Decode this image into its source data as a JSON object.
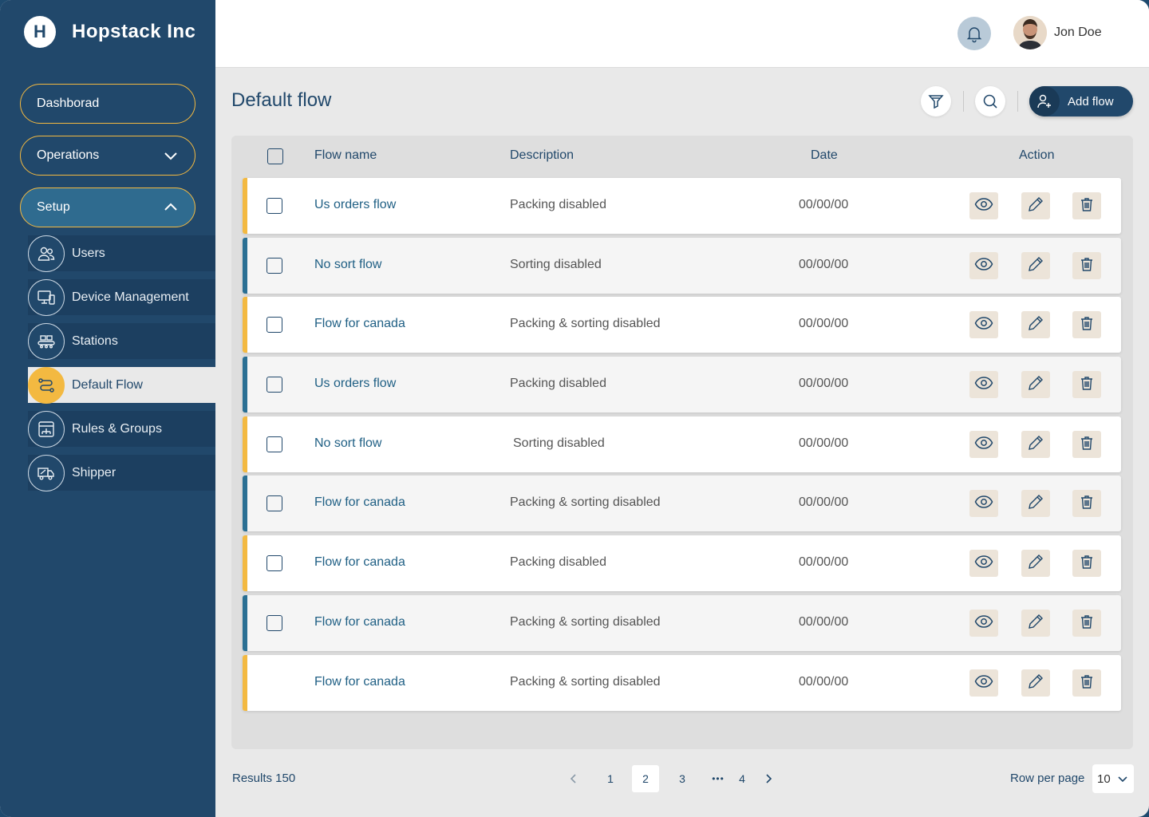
{
  "brand": {
    "logo_text": "H",
    "name": "Hopstack Inc"
  },
  "nav": {
    "dashboard": "Dashborad",
    "operations": "Operations",
    "setup": "Setup",
    "setup_items": [
      {
        "label": "Users",
        "icon": "users-icon"
      },
      {
        "label": "Device Management",
        "icon": "devices-icon"
      },
      {
        "label": "Stations",
        "icon": "stations-icon"
      },
      {
        "label": "Default Flow",
        "icon": "flow-icon"
      },
      {
        "label": "Rules & Groups",
        "icon": "rules-icon"
      },
      {
        "label": "Shipper",
        "icon": "truck-icon"
      }
    ]
  },
  "user": {
    "name": "Jon Doe"
  },
  "page": {
    "title": "Default flow",
    "add_label": "Add flow"
  },
  "table": {
    "headers": {
      "name": "Flow name",
      "description": "Description",
      "date": "Date",
      "action": "Action"
    },
    "rows": [
      {
        "name": "Us orders flow",
        "description": "Packing disabled",
        "date": "00/00/00",
        "stripe": "#f3b941"
      },
      {
        "name": "No sort flow",
        "description": "Sorting disabled",
        "date": "00/00/00",
        "stripe": "#2a6f93"
      },
      {
        "name": "Flow for canada",
        "description": "Packing & sorting disabled",
        "date": "00/00/00",
        "stripe": "#f3b941"
      },
      {
        "name": "Us orders flow",
        "description": "Packing disabled",
        "date": "00/00/00",
        "stripe": "#2a6f93"
      },
      {
        "name": "No sort flow",
        "description": "Sorting disabled",
        "date": "00/00/00",
        "stripe": "#f3b941"
      },
      {
        "name": "Flow for canada",
        "description": "Packing & sorting disabled",
        "date": "00/00/00",
        "stripe": "#2a6f93"
      },
      {
        "name": "Flow for canada",
        "description": "Packing disabled",
        "date": "00/00/00",
        "stripe": "#f3b941"
      },
      {
        "name": "Flow for canada",
        "description": "Packing & sorting disabled",
        "date": "00/00/00",
        "stripe": "#2a6f93"
      },
      {
        "name": "Flow for canada",
        "description": "Packing & sorting disabled",
        "date": "00/00/00",
        "stripe": "#f3b941"
      }
    ]
  },
  "footer": {
    "results": "Results 150",
    "pages": [
      "1",
      "2",
      "3",
      "4"
    ],
    "ellipsis": "•••",
    "current_page": "2",
    "rows_per_page_label": "Row per page",
    "rows_per_page_value": "10"
  },
  "colors": {
    "primary": "#21486b",
    "accent": "#f3b941",
    "teal": "#2a6f93"
  }
}
